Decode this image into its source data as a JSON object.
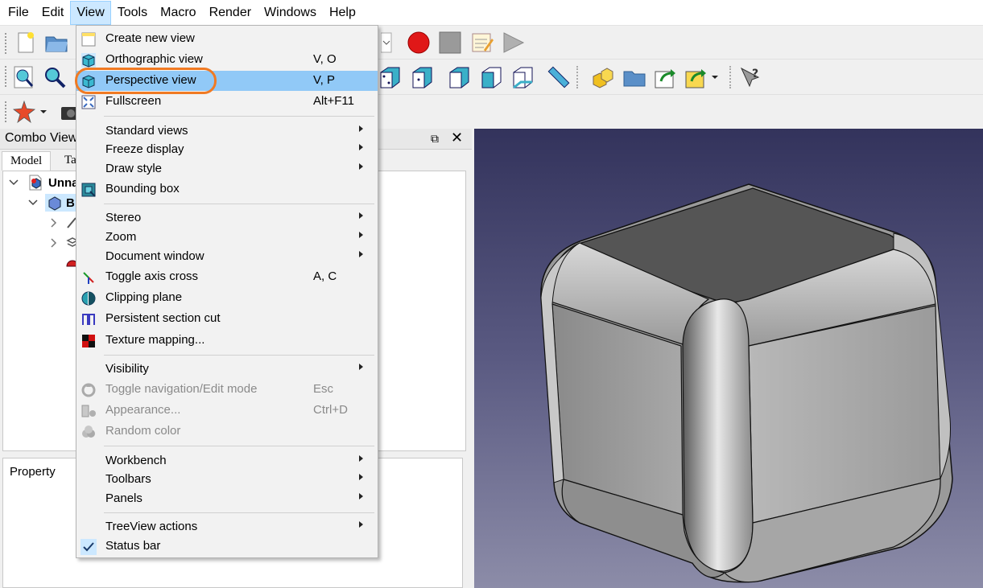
{
  "menubar": {
    "items": [
      "File",
      "Edit",
      "View",
      "Tools",
      "Macro",
      "Render",
      "Windows",
      "Help"
    ],
    "active": "View"
  },
  "combo_view": {
    "title": "Combo View",
    "tabs": [
      "Model",
      "Ta"
    ],
    "tree": [
      {
        "label": "Unna"
      },
      {
        "label": "B"
      }
    ],
    "property_label": "Property"
  },
  "view_menu": {
    "items": [
      {
        "label": "Create new view",
        "shortcut": "",
        "icon": "new-view-icon",
        "submenu": false
      },
      {
        "label": "Orthographic view",
        "shortcut": "V, O",
        "icon": "orthographic-cube-icon",
        "submenu": false
      },
      {
        "label": "Perspective view",
        "shortcut": "V, P",
        "icon": "perspective-cube-icon",
        "submenu": false,
        "highlighted": true
      },
      {
        "label": "Fullscreen",
        "shortcut": "Alt+F11",
        "icon": "fullscreen-icon",
        "submenu": false
      },
      {
        "label": "Standard views",
        "shortcut": "",
        "submenu": true
      },
      {
        "label": "Freeze display",
        "shortcut": "",
        "submenu": true
      },
      {
        "label": "Draw style",
        "shortcut": "",
        "submenu": true
      },
      {
        "label": "Bounding box",
        "shortcut": "",
        "icon": "bounding-box-icon",
        "submenu": false
      },
      {
        "label": "Stereo",
        "shortcut": "",
        "submenu": true
      },
      {
        "label": "Zoom",
        "shortcut": "",
        "submenu": true
      },
      {
        "label": "Document window",
        "shortcut": "",
        "submenu": true
      },
      {
        "label": "Toggle axis cross",
        "shortcut": "A, C",
        "icon": "axis-cross-icon",
        "submenu": false
      },
      {
        "label": "Clipping plane",
        "shortcut": "",
        "icon": "clipping-plane-icon",
        "submenu": false
      },
      {
        "label": "Persistent section cut",
        "shortcut": "",
        "icon": "section-cut-icon",
        "submenu": false
      },
      {
        "label": "Texture mapping...",
        "shortcut": "",
        "icon": "texture-mapping-icon",
        "submenu": false
      },
      {
        "label": "Visibility",
        "shortcut": "",
        "submenu": true
      },
      {
        "label": "Toggle navigation/Edit mode",
        "shortcut": "Esc",
        "icon": "navigation-mode-icon",
        "submenu": false,
        "disabled": true
      },
      {
        "label": "Appearance...",
        "shortcut": "Ctrl+D",
        "icon": "appearance-icon",
        "submenu": false,
        "disabled": true
      },
      {
        "label": "Random color",
        "shortcut": "",
        "icon": "random-color-icon",
        "submenu": false,
        "disabled": true
      },
      {
        "label": "Workbench",
        "shortcut": "",
        "submenu": true
      },
      {
        "label": "Toolbars",
        "shortcut": "",
        "submenu": true
      },
      {
        "label": "Panels",
        "shortcut": "",
        "submenu": true
      },
      {
        "label": "TreeView actions",
        "shortcut": "",
        "submenu": true
      },
      {
        "label": "Status bar",
        "shortcut": "",
        "submenu": false,
        "checked": true
      }
    ]
  },
  "colors": {
    "menu_highlight": "#91c9f7",
    "annotation_ring": "#f07a23",
    "view_background_top": "#33335c",
    "view_background_bottom": "#8c8ca8"
  }
}
